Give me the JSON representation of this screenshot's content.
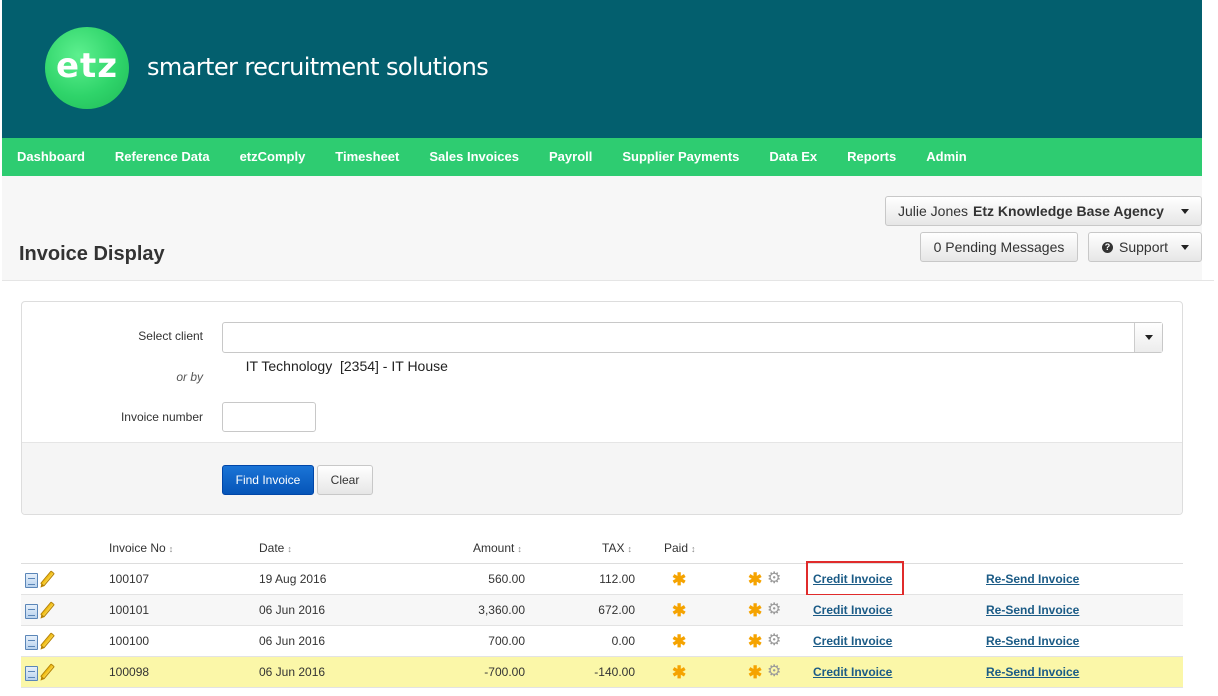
{
  "brand": {
    "logo_text": "etz",
    "tagline": "smarter recruitment solutions"
  },
  "nav": [
    "Dashboard",
    "Reference Data",
    "etzComply",
    "Timesheet",
    "Sales Invoices",
    "Payroll",
    "Supplier Payments",
    "Data Ex",
    "Reports",
    "Admin"
  ],
  "user_menu": {
    "name": "Julie Jones",
    "agency": "Etz Knowledge Base Agency"
  },
  "messages_label": "0 Pending Messages",
  "support_label": "Support",
  "page_title": "Invoice Display",
  "form": {
    "client_label": "Select client",
    "client_value": "IT Technology  [2354] - IT House",
    "or_by": "or by",
    "invoice_number_label": "Invoice number",
    "invoice_number_value": "",
    "find_label": "Find Invoice",
    "clear_label": "Clear"
  },
  "table": {
    "headers": {
      "invoice_no": "Invoice No",
      "date": "Date",
      "amount": "Amount",
      "tax": "TAX",
      "paid": "Paid"
    },
    "sort_glyph": "↕",
    "rows": [
      {
        "invoice_no": "100107",
        "date": "19 Aug 2016",
        "amount": "560.00",
        "tax": "112.00",
        "credit": "Credit Invoice",
        "resend": "Re-Send Invoice"
      },
      {
        "invoice_no": "100101",
        "date": "06 Jun 2016",
        "amount": "3,360.00",
        "tax": "672.00",
        "credit": "Credit Invoice",
        "resend": "Re-Send Invoice"
      },
      {
        "invoice_no": "100100",
        "date": "06 Jun 2016",
        "amount": "700.00",
        "tax": "0.00",
        "credit": "Credit Invoice",
        "resend": "Re-Send Invoice"
      },
      {
        "invoice_no": "100098",
        "date": "06 Jun 2016",
        "amount": "-700.00",
        "tax": "-140.00",
        "credit": "Credit Invoice",
        "resend": "Re-Send Invoice"
      }
    ]
  },
  "colors": {
    "header_bg": "#035f6e",
    "nav_bg": "#2ecc71",
    "highlight_row": "#fbf7a8",
    "annotation_box": "#e02b2b"
  },
  "icons": {
    "doc": "document-icon",
    "edit": "pencil-icon",
    "paid": "asterisk-icon",
    "settings": "gear-icon"
  }
}
